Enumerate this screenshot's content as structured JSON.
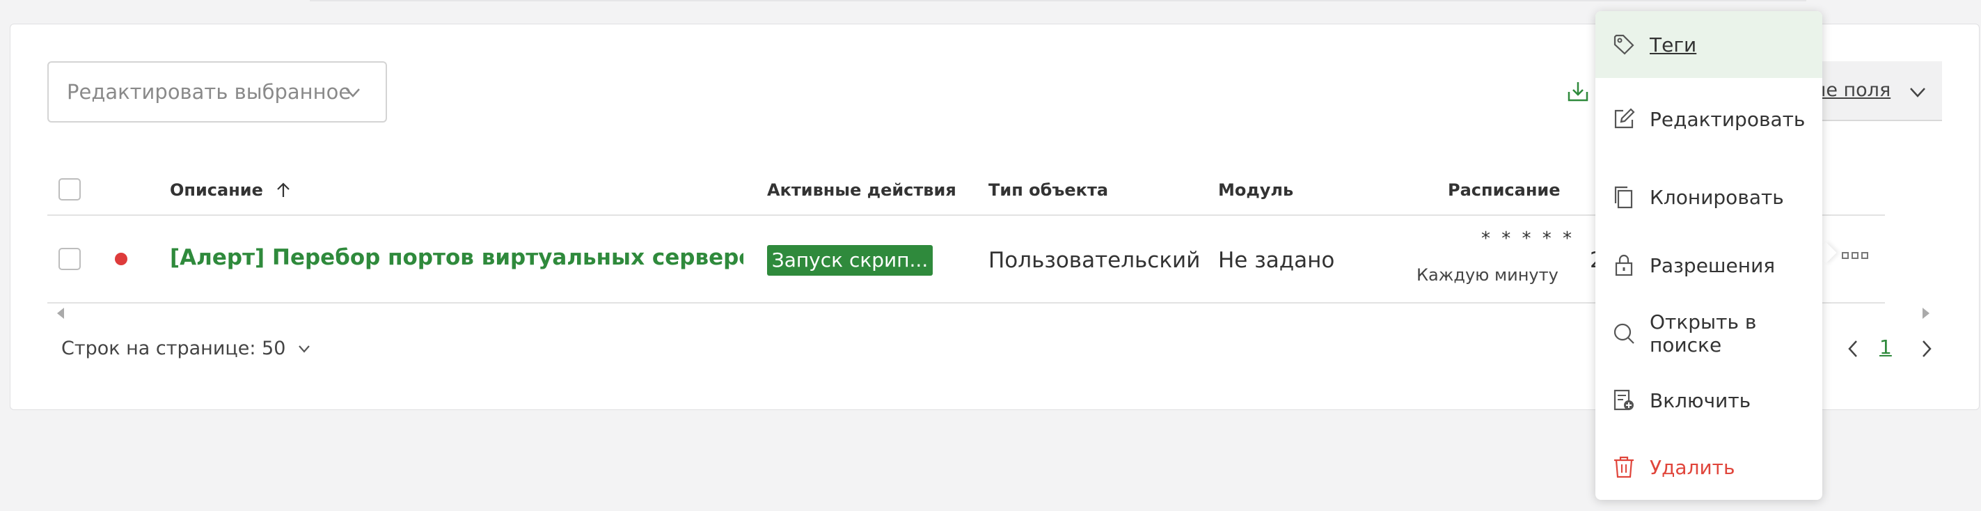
{
  "toolbar": {
    "edit_selected": "Редактировать выбранное",
    "fields_toggle": "ые поля"
  },
  "table": {
    "headers": {
      "description": "Описание",
      "active_actions": "Активные действия",
      "object_type": "Тип объекта",
      "module": "Модуль",
      "schedule": "Расписание"
    },
    "rows": [
      {
        "status_color": "#de3b3b",
        "description": "[Алерт] Перебор портов виртуальных серверов системны",
        "active_action": "Запуск скрип...",
        "object_type": "Пользовательский",
        "module": "Не задано",
        "schedule_cron": "* * * * *",
        "schedule_text": "Каждую минуту",
        "hidden_fragment": "2"
      }
    ]
  },
  "footer": {
    "rows_per_page": "Строк на странице: 50",
    "current_page": "1"
  },
  "context_menu": {
    "items": [
      {
        "label": "Теги",
        "icon": "tag-icon"
      },
      {
        "label": "Редактировать",
        "icon": "edit-icon"
      },
      {
        "label": "Клонировать",
        "icon": "clone-icon"
      },
      {
        "label": "Разрешения",
        "icon": "lock-icon"
      },
      {
        "label": "Открыть в поиске",
        "icon": "search-icon"
      },
      {
        "label": "Включить",
        "icon": "enable-icon"
      },
      {
        "label": "Удалить",
        "icon": "trash-icon"
      }
    ]
  },
  "colors": {
    "accent": "#2f8a3c",
    "danger": "#e0453b",
    "menu_active_bg": "#eaf3ea"
  }
}
